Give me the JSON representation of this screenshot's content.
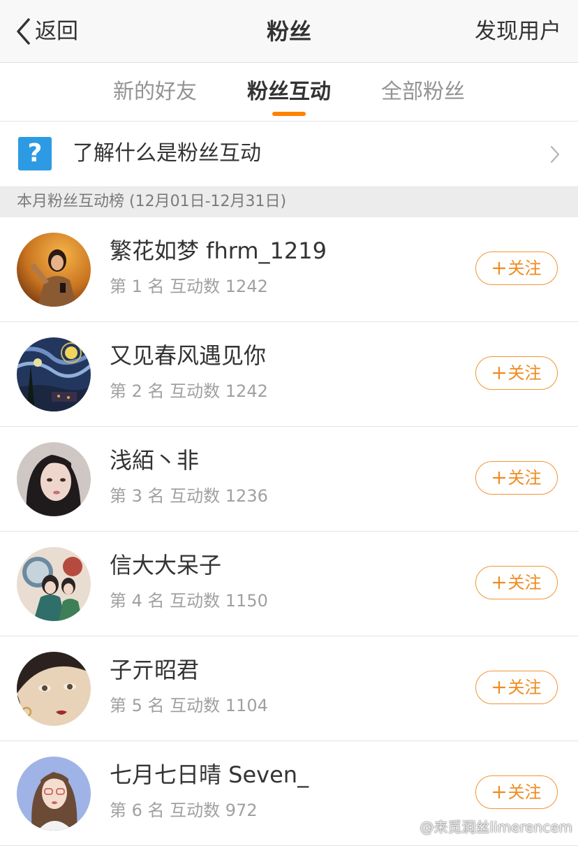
{
  "nav": {
    "back_label": "返回",
    "title": "粉丝",
    "right_action": "发现用户"
  },
  "tabs": [
    {
      "label": "新的好友",
      "active": false
    },
    {
      "label": "粉丝互动",
      "active": true
    },
    {
      "label": "全部粉丝",
      "active": false
    }
  ],
  "info_row": {
    "icon": "question-icon",
    "icon_glyph": "?",
    "label": "了解什么是粉丝互动"
  },
  "section": {
    "title": "本月粉丝互动榜 (12月01日-12月31日)"
  },
  "fans": [
    {
      "name": "繁花如梦 fhrm_1219",
      "meta": "第 1 名  互动数 1242",
      "follow_label": "关注"
    },
    {
      "name": "又见春风遇见你",
      "meta": "第 2 名  互动数 1242",
      "follow_label": "关注"
    },
    {
      "name": "浅絔丶非",
      "meta": "第 3 名  互动数 1236",
      "follow_label": "关注"
    },
    {
      "name": "信大大呆子",
      "meta": "第 4 名  互动数 1150",
      "follow_label": "关注"
    },
    {
      "name": "子亓昭君",
      "meta": "第 5 名  互动数 1104",
      "follow_label": "关注"
    },
    {
      "name": "七月七日晴 Seven_",
      "meta": "第 6 名  互动数 972",
      "follow_label": "关注"
    }
  ],
  "watermark": "@来觅润丝limerencem",
  "colors": {
    "accent": "#ff8200",
    "follow_border": "#f29434",
    "info_icon_bg": "#2d9be3",
    "navbar_bg": "#f8f8f8",
    "section_bg": "#ececec"
  }
}
